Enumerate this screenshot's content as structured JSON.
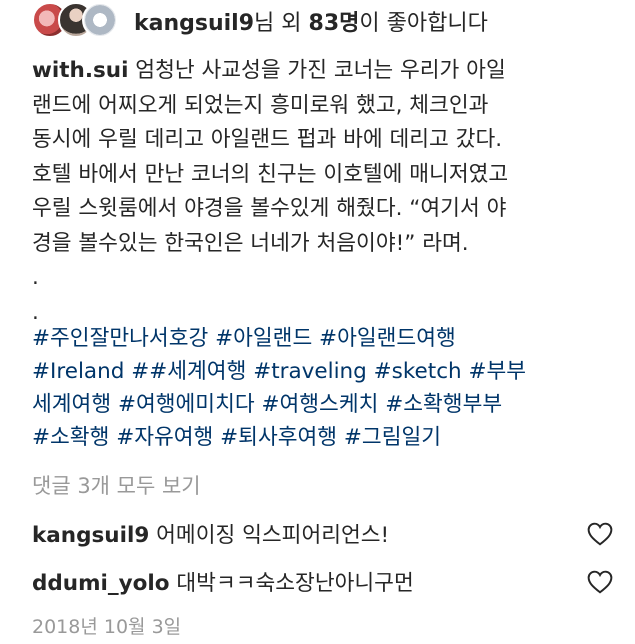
{
  "likes": {
    "username": "kangsuil9",
    "suffix_pre": "님 외 ",
    "count": "83명",
    "suffix_post": "이 좋아합니다"
  },
  "caption": {
    "username": "with.sui",
    "lines": [
      " 엄청난 사교성을 가진 코너는 우리가 아일",
      "랜드에 어찌오게 되었는지 흥미로워 했고, 체크인과",
      "동시에 우릴 데리고 아일랜드 펍과 바에 데리고 갔다.",
      "호텔 바에서 만난 코너의 친구는 이호텔에 매니저였고",
      "우릴 스윗룸에서 야경을 볼수있게 해줬다. “여기서 야",
      "경을 볼수있는 한국인은 너네가 처음이야!” 라며."
    ],
    "dots": [
      ".",
      "."
    ]
  },
  "hashtags": {
    "lines": [
      "#주인잘만나서호강 #아일랜드 #아일랜드여행",
      "#Ireland ##세계여행 #traveling #sketch  #부부",
      "세계여행 #여행에미치다 #여행스케치 #소확행부부",
      "#소확행  #자유여행 #퇴사후여행 #그림일기"
    ]
  },
  "view_comments": "댓글 3개 모두 보기",
  "comments": [
    {
      "username": "kangsuil9",
      "text": " 어메이징 익스피어리언스!",
      "like_icon": "heart-outline-icon"
    },
    {
      "username": "ddumi_yolo",
      "text": " 대박ㅋㅋ숙소장난아니구먼",
      "like_icon": "heart-outline-icon"
    }
  ],
  "date": "2018년 10월 3일",
  "colors": {
    "hashtag": "#003569",
    "muted": "#999999",
    "text": "#262626"
  }
}
